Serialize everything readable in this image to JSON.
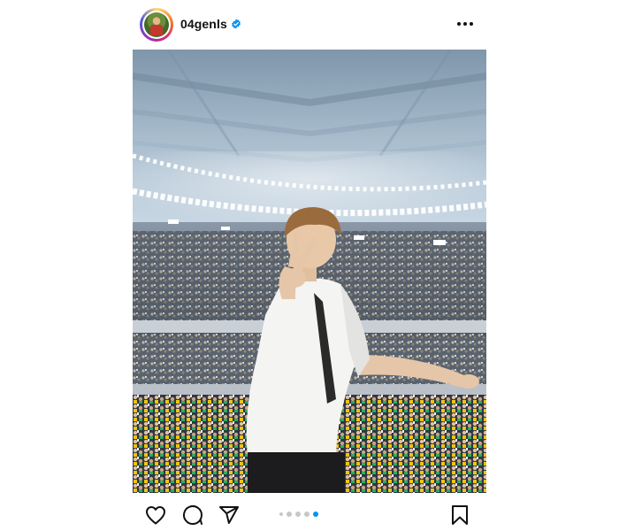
{
  "post": {
    "username": "04genls",
    "verified": true,
    "carousel": {
      "total_visible_dots": 5,
      "active_index": 4
    }
  },
  "icons": {
    "more": "more-horizontal-icon",
    "like": "heart-icon",
    "comment": "comment-icon",
    "share": "send-icon",
    "save": "bookmark-icon",
    "verified": "verified-badge-icon"
  },
  "colors": {
    "verified_blue": "#0095f6",
    "active_dot": "#0095f6",
    "inactive_dot": "#c7c7c7",
    "text": "#111111"
  }
}
